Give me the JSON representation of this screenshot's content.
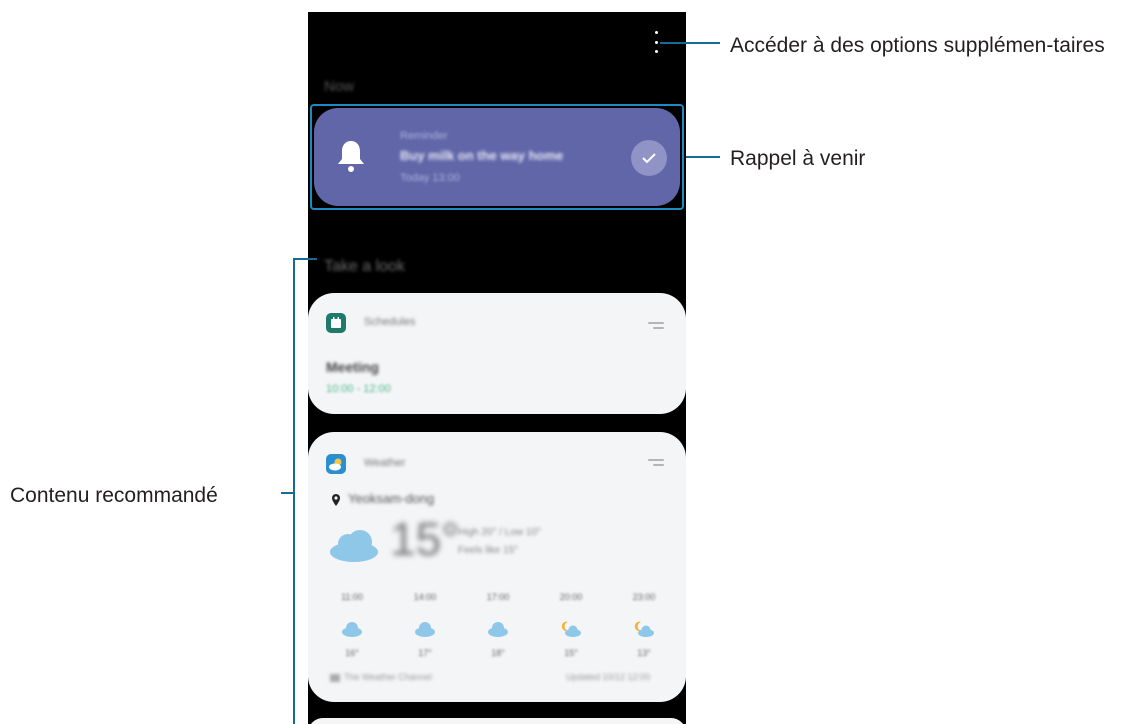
{
  "annotations": {
    "options": "Accéder à des options supplémen-taires",
    "reminder": "Rappel à venir",
    "content": "Contenu recommandé"
  },
  "screen": {
    "now_label": "Now",
    "look_label": "Take a look",
    "reminder": {
      "kicker": "Reminder",
      "title": "Buy milk on the way home",
      "time": "Today 13:00"
    },
    "schedules": {
      "app_name": "Schedules",
      "event_title": "Meeting",
      "event_time": "10:00 - 12:00"
    },
    "weather": {
      "app_name": "Weather",
      "location": "Yeoksam-dong",
      "temperature": "15°",
      "high_low": "High 20° / Low 10°",
      "feels_like": "Feels like 15°",
      "hours": [
        {
          "time": "11:00",
          "temp": "16°",
          "icon": "cloud-icon"
        },
        {
          "time": "14:00",
          "temp": "17°",
          "icon": "cloud-icon"
        },
        {
          "time": "17:00",
          "temp": "18°",
          "icon": "cloud-icon"
        },
        {
          "time": "20:00",
          "temp": "15°",
          "icon": "moon-cloud-icon"
        },
        {
          "time": "23:00",
          "temp": "13°",
          "icon": "moon-cloud-icon"
        }
      ],
      "source": "The Weather Channel",
      "updated": "Updated 10/12 12:00"
    }
  },
  "colors": {
    "reminder_card": "#6066a8",
    "highlight_frame": "#1d8ac4",
    "leader_line": "#1a6a97",
    "schedules_icon": "#1f7a6d",
    "weather_icon": "#2a8fd0"
  }
}
